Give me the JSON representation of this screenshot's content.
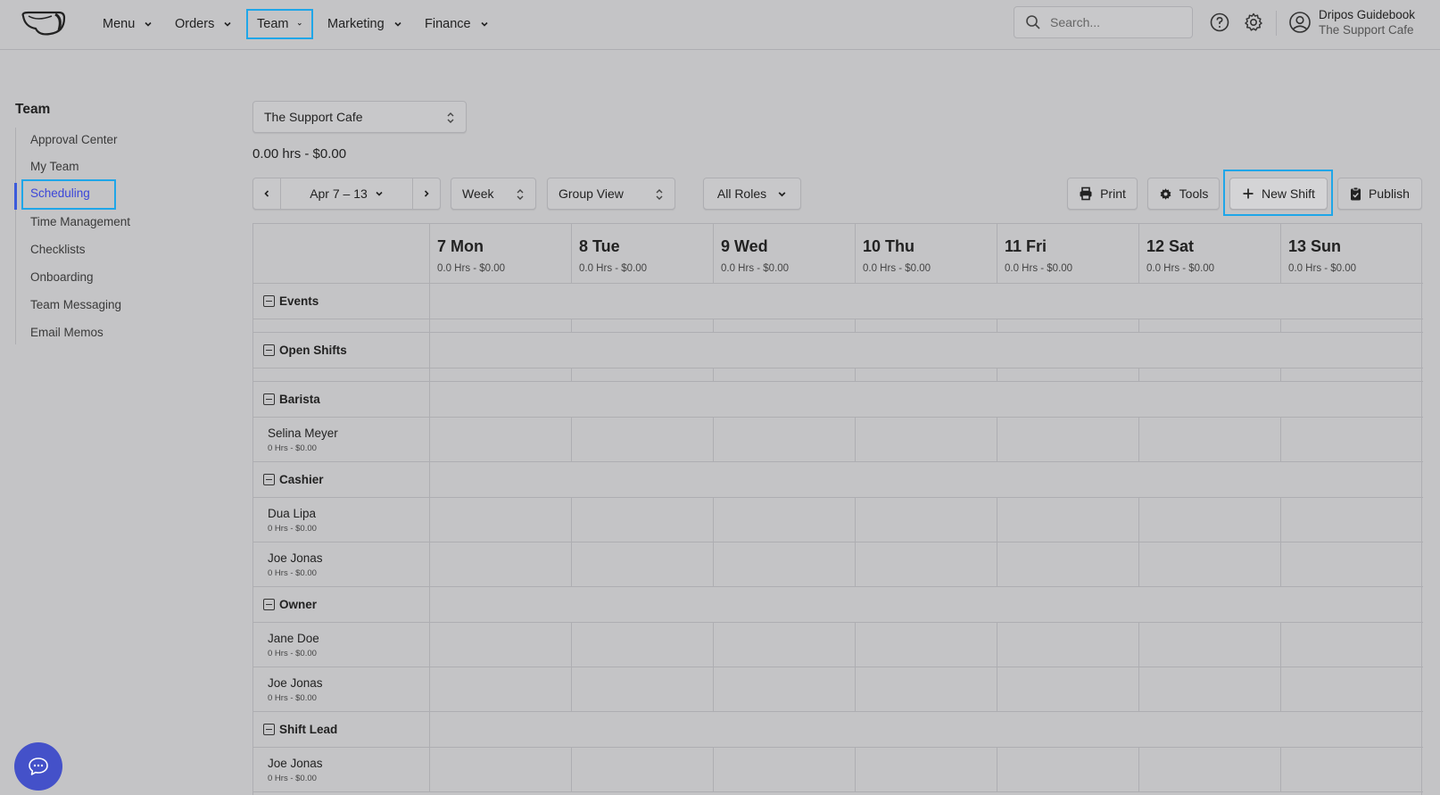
{
  "nav": {
    "items": [
      {
        "label": "Menu"
      },
      {
        "label": "Orders"
      },
      {
        "label": "Team"
      },
      {
        "label": "Marketing"
      },
      {
        "label": "Finance"
      }
    ],
    "search_placeholder": "Search...",
    "user_name": "Dripos Guidebook",
    "user_location": "The Support Cafe"
  },
  "sidebar": {
    "title": "Team",
    "items": [
      {
        "label": "Approval Center"
      },
      {
        "label": "My Team"
      },
      {
        "label": "Scheduling"
      },
      {
        "label": "Time Management"
      },
      {
        "label": "Checklists"
      },
      {
        "label": "Onboarding"
      },
      {
        "label": "Team Messaging"
      },
      {
        "label": "Email Memos"
      }
    ],
    "active": "Scheduling"
  },
  "controls": {
    "location": "The Support Cafe",
    "summary": "0.00 hrs - $0.00",
    "date_range": "Apr 7 – 13",
    "view_period": "Week",
    "view_mode": "Group View",
    "roles": "All Roles",
    "print_label": "Print",
    "tools_label": "Tools",
    "new_shift_label": "New Shift",
    "publish_label": "Publish"
  },
  "schedule": {
    "days": [
      {
        "name": "7 Mon",
        "summary": "0.0 Hrs - $0.00"
      },
      {
        "name": "8 Tue",
        "summary": "0.0 Hrs - $0.00"
      },
      {
        "name": "9 Wed",
        "summary": "0.0 Hrs - $0.00"
      },
      {
        "name": "10 Thu",
        "summary": "0.0 Hrs - $0.00"
      },
      {
        "name": "11 Fri",
        "summary": "0.0 Hrs - $0.00"
      },
      {
        "name": "12 Sat",
        "summary": "0.0 Hrs - $0.00"
      },
      {
        "name": "13 Sun",
        "summary": "0.0 Hrs - $0.00"
      }
    ],
    "groups": {
      "events": "Events",
      "open_shifts": "Open Shifts",
      "barista": "Barista",
      "cashier": "Cashier",
      "owner": "Owner",
      "shift_lead": "Shift Lead"
    },
    "employees": {
      "selina": {
        "name": "Selina Meyer",
        "summary": "0 Hrs - $0.00"
      },
      "dua": {
        "name": "Dua Lipa",
        "summary": "0 Hrs - $0.00"
      },
      "joe_cashier": {
        "name": "Joe Jonas",
        "summary": "0 Hrs - $0.00"
      },
      "jane": {
        "name": "Jane Doe",
        "summary": "0 Hrs - $0.00"
      },
      "joe_owner": {
        "name": "Joe Jonas",
        "summary": "0 Hrs - $0.00"
      },
      "joe_lead": {
        "name": "Joe Jonas",
        "summary": "0 Hrs - $0.00"
      }
    }
  },
  "colors": {
    "accent": "#3b46d9",
    "highlight": "#1fa6e8",
    "chat": "#4451c9",
    "background": "#c4c4c6"
  },
  "icons": [
    "logo-cup-icon",
    "chevron-down-icon",
    "search-icon",
    "help-icon",
    "gear-icon",
    "user-icon",
    "updown-icon",
    "chevron-left-icon",
    "chevron-right-icon",
    "printer-icon",
    "plus-icon",
    "clipboard-check-icon",
    "collapse-icon",
    "chat-icon"
  ]
}
